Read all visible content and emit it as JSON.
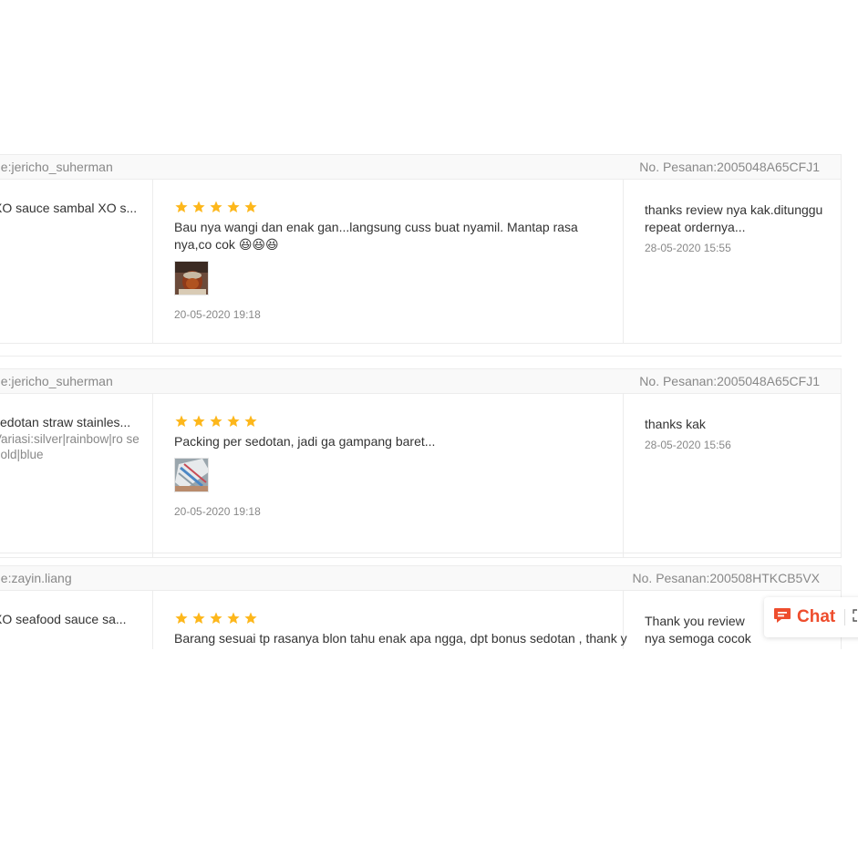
{
  "colors": {
    "star": "#fdb71b",
    "chat_accent": "#ee4d2d",
    "border": "#ececec",
    "header_bg": "#f9f9f9"
  },
  "reviews": [
    {
      "buyer": "ne:jericho_suherman",
      "order_no": "No. Pesanan:2005048A65CFJ1",
      "product": "XO sauce sambal XO s...",
      "variation": "",
      "rating": 5,
      "text": "Bau nya wangi dan enak gan...langsung cuss buat nyamil. Mantap rasa nya,co cok 😆😆😆",
      "photo": "sauce-jar-photo",
      "date": "20-05-2020 19:18",
      "reply": "thanks review nya kak.ditunggu repeat ordernya...",
      "reply_date": "28-05-2020 15:55"
    },
    {
      "buyer": "ne:jericho_suherman",
      "order_no": "No. Pesanan:2005048A65CFJ1",
      "product": "sedotan straw stainles...",
      "variation": "Variasi:silver|rainbow|ro se gold|blue",
      "rating": 5,
      "text": "Packing per sedotan, jadi ga gampang baret...",
      "photo": "straw-package-photo",
      "date": "20-05-2020 19:18",
      "reply": "thanks kak",
      "reply_date": "28-05-2020 15:56"
    },
    {
      "buyer": "ne:zayin.liang",
      "order_no": "No. Pesanan:200508HTKCB5VX",
      "product": "XO seafood sauce sa...",
      "variation": "",
      "rating": 5,
      "text": "Barang sesuai tp rasanya blon tahu enak apa ngga, dpt bonus sedotan , thank y",
      "photo": "",
      "date": "",
      "reply": "Thank you review nya semoga cocok ya :)",
      "reply_date": ""
    }
  ],
  "chat": {
    "label": "Chat",
    "icon": "chat-bubble-icon",
    "expand_icon": "expand-icon"
  }
}
